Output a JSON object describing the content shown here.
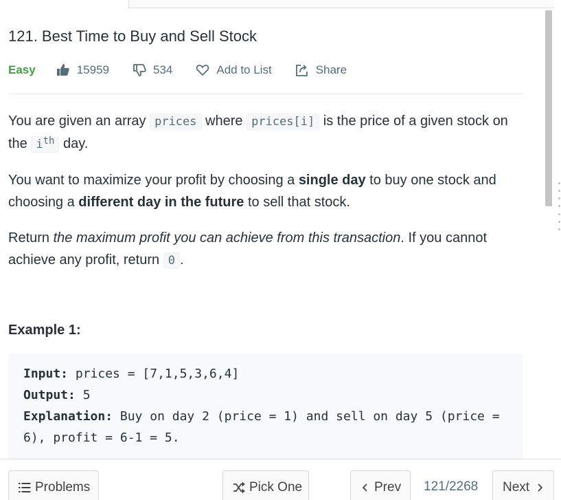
{
  "problem": {
    "title": "121. Best Time to Buy and Sell Stock",
    "difficulty": "Easy",
    "likes": "15959",
    "dislikes": "534",
    "add_to_list_label": "Add to List",
    "share_label": "Share"
  },
  "description": {
    "p1": {
      "t1": "You are given an array ",
      "code1": "prices",
      "t2": " where ",
      "code2": "prices[i]",
      "t3": " is the price of a given stock on the ",
      "code3": "i",
      "sup": "th",
      "t4": " day."
    },
    "p2": {
      "t1": "You want to maximize your profit by choosing a ",
      "b1": "single day",
      "t2": " to buy one stock and choosing a ",
      "b2": "different day in the future",
      "t3": " to sell that stock."
    },
    "p3": {
      "t1": "Return ",
      "i1": "the maximum profit you can achieve from this transaction",
      "t2": ". If you cannot achieve any profit, return ",
      "code1": "0",
      "t3": "."
    }
  },
  "example1": {
    "title": "Example 1:",
    "input_label": "Input:",
    "input_value": " prices = [7,1,5,3,6,4]",
    "output_label": "Output:",
    "output_value": " 5",
    "explanation_label": "Explanation:",
    "explanation_value": " Buy on day 2 (price = 1) and sell on day 5 (price = 6), profit = 6-1 = 5."
  },
  "footer": {
    "problems_label": "Problems",
    "pick_one_label": "Pick One",
    "prev_label": "Prev",
    "counter": "121/2268",
    "next_label": "Next"
  },
  "colors": {
    "easy": "#43a047",
    "meta_text": "#546e7a",
    "code_bg": "#f5f7f9",
    "example_bg": "#f7f9fa"
  },
  "icons": {
    "like": "thumbs-up-icon",
    "dislike": "thumbs-down-icon",
    "add_to_list": "heart-icon",
    "share": "share-icon",
    "problems": "list-icon",
    "pick_one": "shuffle-icon",
    "prev": "chevron-left-icon",
    "next": "chevron-right-icon"
  }
}
